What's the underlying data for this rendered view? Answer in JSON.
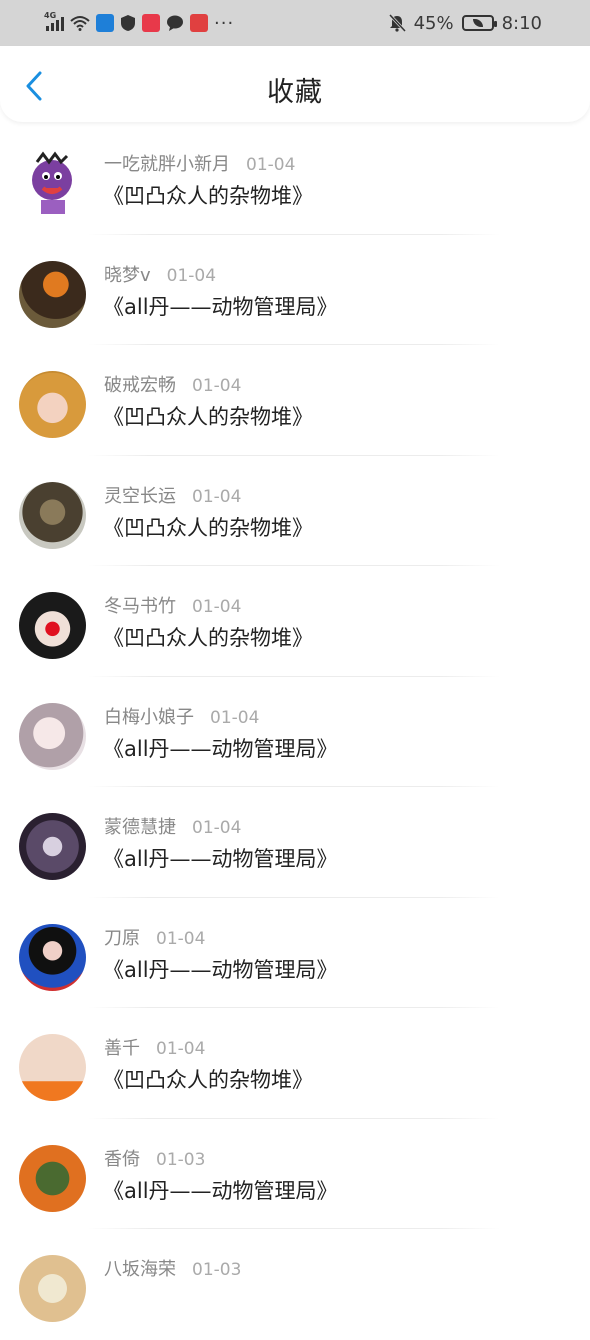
{
  "status_bar": {
    "network": "4G",
    "battery": "45%",
    "time": "8:10",
    "more": "···"
  },
  "header": {
    "title": "收藏",
    "back_icon": "chevron-left-icon"
  },
  "colors": {
    "accent": "#1a8fe0",
    "status_bar_bg": "#d5d5d5",
    "username": "#888888",
    "title_text": "#222222"
  },
  "favorites": [
    {
      "user": "一吃就胖小新月",
      "date": "01-04",
      "title": "《凹凸众人的杂物堆》"
    },
    {
      "user": "晓梦v",
      "date": "01-04",
      "title": "《all丹——动物管理局》"
    },
    {
      "user": "破戒宏畅",
      "date": "01-04",
      "title": "《凹凸众人的杂物堆》"
    },
    {
      "user": "灵空长运",
      "date": "01-04",
      "title": "《凹凸众人的杂物堆》"
    },
    {
      "user": "冬马书竹",
      "date": "01-04",
      "title": "《凹凸众人的杂物堆》"
    },
    {
      "user": "白梅小娘子",
      "date": "01-04",
      "title": "《all丹——动物管理局》"
    },
    {
      "user": "蒙德慧捷",
      "date": "01-04",
      "title": "《all丹——动物管理局》"
    },
    {
      "user": "刀原",
      "date": "01-04",
      "title": "《all丹——动物管理局》"
    },
    {
      "user": "善千",
      "date": "01-04",
      "title": "《凹凸众人的杂物堆》"
    },
    {
      "user": "香倚",
      "date": "01-03",
      "title": "《all丹——动物管理局》"
    },
    {
      "user": "八坂海荣",
      "date": "01-03",
      "title": ""
    }
  ]
}
